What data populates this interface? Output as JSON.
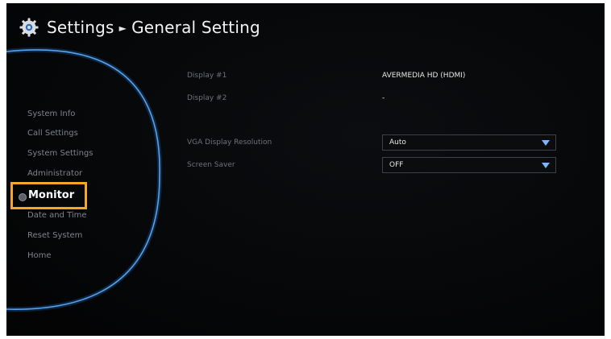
{
  "header": {
    "section": "Settings",
    "page": "General Setting",
    "icon": "gear-icon"
  },
  "sidebar": {
    "items": [
      {
        "label": "System Info"
      },
      {
        "label": "Call Settings"
      },
      {
        "label": "System Settings"
      },
      {
        "label": "Administrator"
      },
      {
        "label": "Monitor"
      },
      {
        "label": "Date and Time"
      },
      {
        "label": "Reset System"
      },
      {
        "label": "Home"
      }
    ],
    "active_index": 4
  },
  "main": {
    "display1": {
      "label": "Display #1",
      "value": "AVERMEDIA HD (HDMI)"
    },
    "display2": {
      "label": "Display #2",
      "value": "-"
    },
    "vga": {
      "label": "VGA Display Resolution",
      "value": "Auto"
    },
    "saver": {
      "label": "Screen Saver",
      "value": "OFF"
    }
  },
  "colors": {
    "background": "#050607",
    "highlight_border": "#f5a623",
    "dropdown_caret": "#7fb4ff",
    "arc_glow": "#3b8fe6"
  }
}
